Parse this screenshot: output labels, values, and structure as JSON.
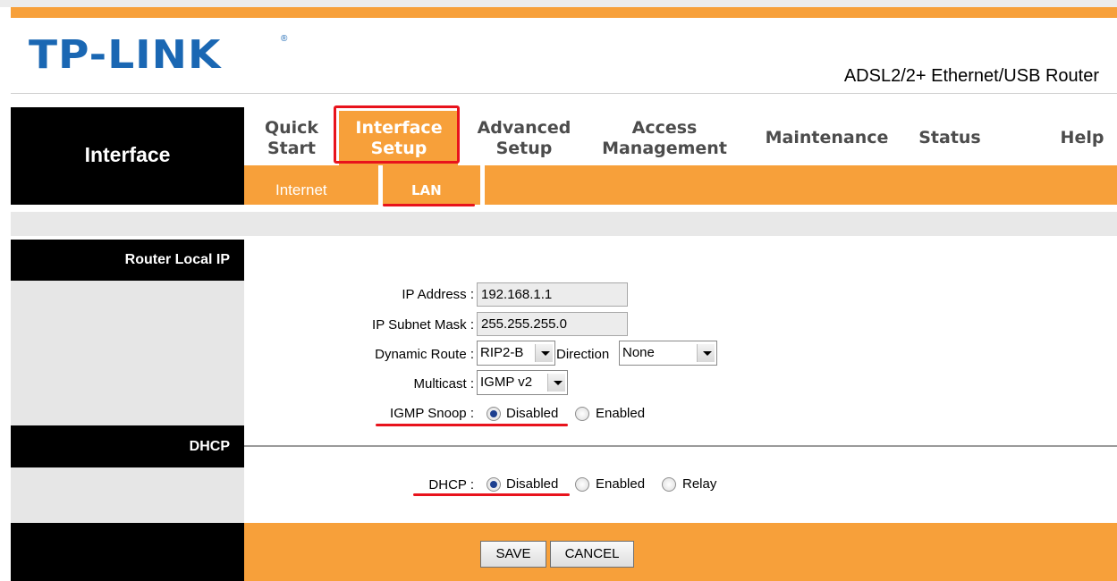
{
  "header": {
    "logo": "TP-LINK",
    "logo_mark": "®",
    "product": "ADSL2/2+ Ethernet/USB Router"
  },
  "nav": {
    "section_title": "Interface",
    "tabs": [
      {
        "label": "Quick Start"
      },
      {
        "label": "Interface Setup",
        "active": true
      },
      {
        "label": "Advanced Setup"
      },
      {
        "label": "Access Management"
      },
      {
        "label": "Maintenance"
      },
      {
        "label": "Status"
      },
      {
        "label": "Help"
      }
    ],
    "subtabs": [
      {
        "label": "Internet"
      },
      {
        "label": "LAN",
        "active": true
      }
    ]
  },
  "sections": {
    "router_local_ip": "Router Local IP",
    "dhcp": "DHCP"
  },
  "form": {
    "ip_address": {
      "label": "IP Address :",
      "value": "192.168.1.1"
    },
    "subnet_mask": {
      "label": "IP Subnet Mask :",
      "value": "255.255.255.0"
    },
    "dynamic_route": {
      "label": "Dynamic Route :",
      "value": "RIP2-B",
      "direction_label": "Direction",
      "direction_value": "None"
    },
    "multicast": {
      "label": "Multicast :",
      "value": "IGMP v2"
    },
    "igmp_snoop": {
      "label": "IGMP Snoop :",
      "options": [
        "Disabled",
        "Enabled"
      ],
      "selected": "Disabled"
    },
    "dhcp": {
      "label": "DHCP :",
      "options": [
        "Disabled",
        "Enabled",
        "Relay"
      ],
      "selected": "Disabled"
    }
  },
  "buttons": {
    "save": "SAVE",
    "cancel": "CANCEL"
  },
  "colors": {
    "brand_blue": "#1a67b3",
    "accent_orange": "#f7a03a",
    "highlight_red": "#e8131c"
  }
}
